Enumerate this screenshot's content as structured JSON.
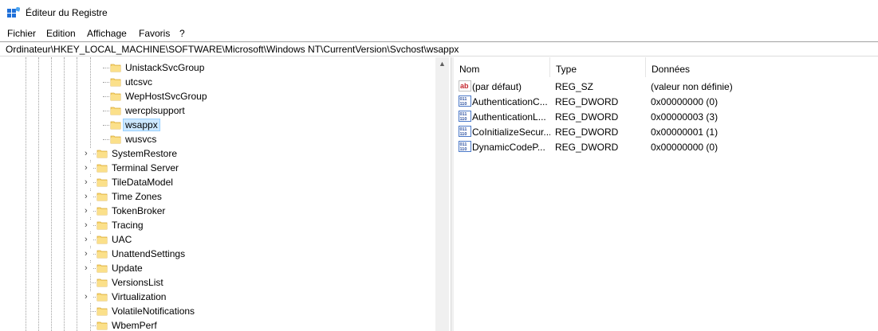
{
  "window": {
    "title": "Éditeur du Registre"
  },
  "menu": [
    "Fichier",
    "Edition",
    "Affichage",
    "Favoris",
    "?"
  ],
  "address": "Ordinateur\\HKEY_LOCAL_MACHINE\\SOFTWARE\\Microsoft\\Windows NT\\CurrentVersion\\Svchost\\wsappx",
  "tree": {
    "items": [
      {
        "label": "UnistackSvcGroup",
        "level": 2,
        "expandable": false,
        "selected": false
      },
      {
        "label": "utcsvc",
        "level": 2,
        "expandable": false,
        "selected": false
      },
      {
        "label": "WepHostSvcGroup",
        "level": 2,
        "expandable": false,
        "selected": false
      },
      {
        "label": "wercplsupport",
        "level": 2,
        "expandable": false,
        "selected": false
      },
      {
        "label": "wsappx",
        "level": 2,
        "expandable": false,
        "selected": true
      },
      {
        "label": "wusvcs",
        "level": 2,
        "expandable": false,
        "selected": false
      },
      {
        "label": "SystemRestore",
        "level": 1,
        "expandable": true,
        "selected": false
      },
      {
        "label": "Terminal Server",
        "level": 1,
        "expandable": true,
        "selected": false
      },
      {
        "label": "TileDataModel",
        "level": 1,
        "expandable": true,
        "selected": false
      },
      {
        "label": "Time Zones",
        "level": 1,
        "expandable": true,
        "selected": false
      },
      {
        "label": "TokenBroker",
        "level": 1,
        "expandable": true,
        "selected": false
      },
      {
        "label": "Tracing",
        "level": 1,
        "expandable": true,
        "selected": false
      },
      {
        "label": "UAC",
        "level": 1,
        "expandable": true,
        "selected": false
      },
      {
        "label": "UnattendSettings",
        "level": 1,
        "expandable": true,
        "selected": false
      },
      {
        "label": "Update",
        "level": 1,
        "expandable": true,
        "selected": false
      },
      {
        "label": "VersionsList",
        "level": 1,
        "expandable": false,
        "selected": false
      },
      {
        "label": "Virtualization",
        "level": 1,
        "expandable": true,
        "selected": false
      },
      {
        "label": "VolatileNotifications",
        "level": 1,
        "expandable": false,
        "selected": false
      },
      {
        "label": "WbemPerf",
        "level": 1,
        "expandable": false,
        "selected": false
      }
    ]
  },
  "list": {
    "columns": [
      "Nom",
      "Type",
      "Données"
    ],
    "rows": [
      {
        "icon": "string-value-icon",
        "name": "(par défaut)",
        "type": "REG_SZ",
        "data": "(valeur non définie)"
      },
      {
        "icon": "binary-value-icon",
        "name": "AuthenticationC...",
        "type": "REG_DWORD",
        "data": "0x00000000 (0)"
      },
      {
        "icon": "binary-value-icon",
        "name": "AuthenticationL...",
        "type": "REG_DWORD",
        "data": "0x00000003 (3)"
      },
      {
        "icon": "binary-value-icon",
        "name": "CoInitializeSecur...",
        "type": "REG_DWORD",
        "data": "0x00000001 (1)"
      },
      {
        "icon": "binary-value-icon",
        "name": "DynamicCodeP...",
        "type": "REG_DWORD",
        "data": "0x00000000 (0)"
      }
    ]
  },
  "colors": {
    "folder": "#f8d775",
    "selection": "#cce8ff",
    "selection_border": "#99d1ff",
    "accent": "#2b6cd4"
  }
}
